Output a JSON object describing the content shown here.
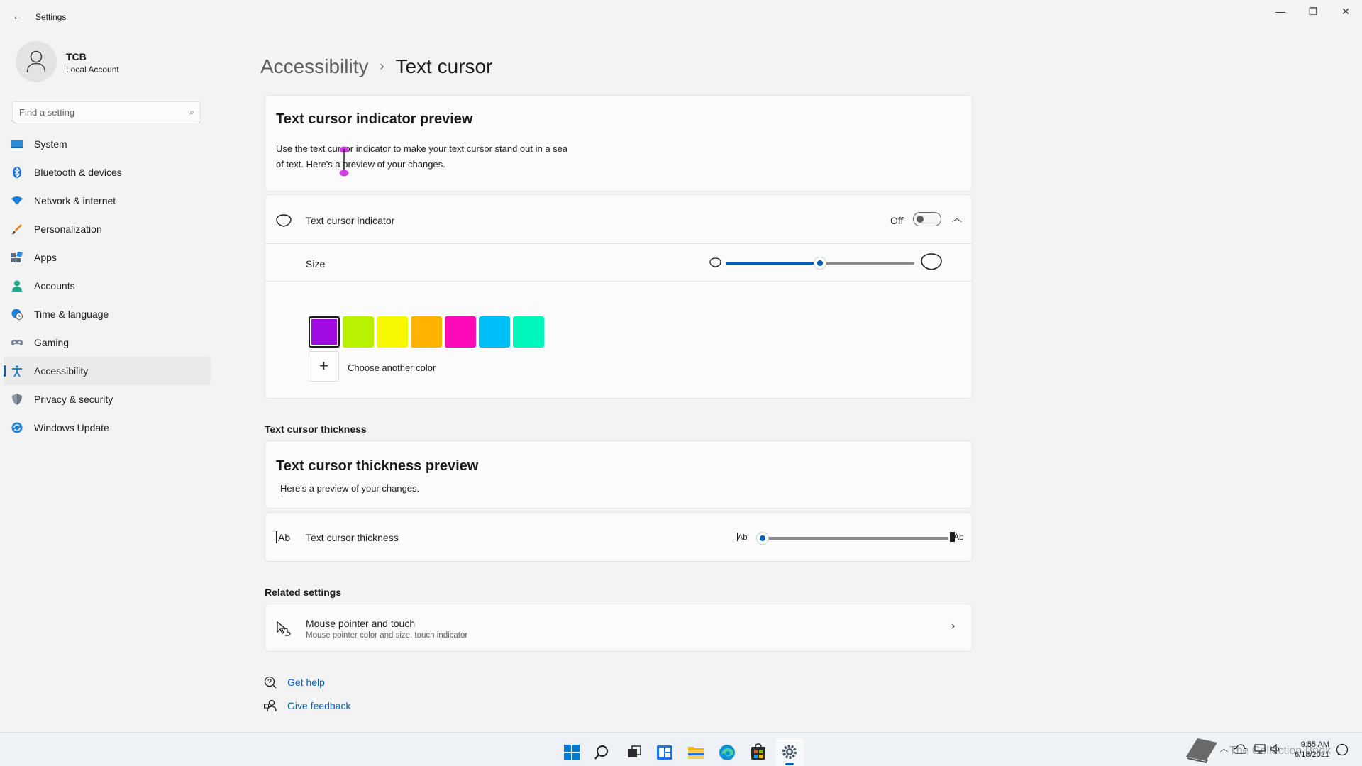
{
  "window": {
    "app_title": "Settings",
    "minimize_glyph": "—",
    "maximize_glyph": "❐",
    "close_glyph": "✕",
    "back_glyph": "←"
  },
  "profile": {
    "name": "TCB",
    "account_type": "Local Account"
  },
  "search": {
    "placeholder": "Find a setting",
    "icon": "search-icon"
  },
  "sidebar": {
    "items": [
      {
        "label": "System",
        "icon": "system-icon"
      },
      {
        "label": "Bluetooth & devices",
        "icon": "bluetooth-icon"
      },
      {
        "label": "Network & internet",
        "icon": "wifi-icon"
      },
      {
        "label": "Personalization",
        "icon": "brush-icon"
      },
      {
        "label": "Apps",
        "icon": "apps-icon"
      },
      {
        "label": "Accounts",
        "icon": "person-icon"
      },
      {
        "label": "Time & language",
        "icon": "globe-clock-icon"
      },
      {
        "label": "Gaming",
        "icon": "gamepad-icon"
      },
      {
        "label": "Accessibility",
        "icon": "accessibility-icon",
        "active": true
      },
      {
        "label": "Privacy & security",
        "icon": "shield-icon"
      },
      {
        "label": "Windows Update",
        "icon": "update-icon"
      }
    ]
  },
  "breadcrumb": {
    "parent": "Accessibility",
    "separator": "›",
    "current": "Text cursor"
  },
  "indicator_preview": {
    "title": "Text cursor indicator preview",
    "text_line1": "Use the text cursor indicator to make your text cursor stand out in a sea",
    "text_line2": "of text. Here's a preview of your changes."
  },
  "indicator_row": {
    "label": "Text cursor indicator",
    "state_label": "Off",
    "toggle_on": false,
    "expanded": true
  },
  "size_row": {
    "label": "Size",
    "slider_value_fraction": 0.5
  },
  "colors": {
    "swatches": [
      "#a10be3",
      "#b8f200",
      "#f7f700",
      "#ffb300",
      "#ff0ab8",
      "#00bef7",
      "#00f7bc"
    ],
    "selected_index": 0,
    "choose_label": "Choose another color",
    "plus_glyph": "+"
  },
  "thickness_section": {
    "heading": "Text cursor thickness",
    "preview_title": "Text cursor thickness preview",
    "preview_text": "Here's a preview of your changes.",
    "row_label": "Text cursor thickness",
    "row_icon_text": "Ab",
    "slider_min_label": "Ab",
    "slider_max_label": "Ab",
    "slider_value_fraction": 0.0
  },
  "related": {
    "heading": "Related settings",
    "items": [
      {
        "title": "Mouse pointer and touch",
        "subtitle": "Mouse pointer color and size, touch indicator"
      }
    ]
  },
  "help_links": {
    "get_help": "Get help",
    "give_feedback": "Give feedback"
  },
  "taskbar": {
    "apps": [
      "start-icon",
      "search-icon",
      "task-view-icon",
      "widgets-icon",
      "file-explorer-icon",
      "edge-icon",
      "store-icon",
      "settings-icon"
    ],
    "active_app": "settings-icon",
    "time": "9:55 AM",
    "date": "6/18/2021",
    "watermark": "The Collection Book"
  },
  "accent_color": "#005fb8"
}
